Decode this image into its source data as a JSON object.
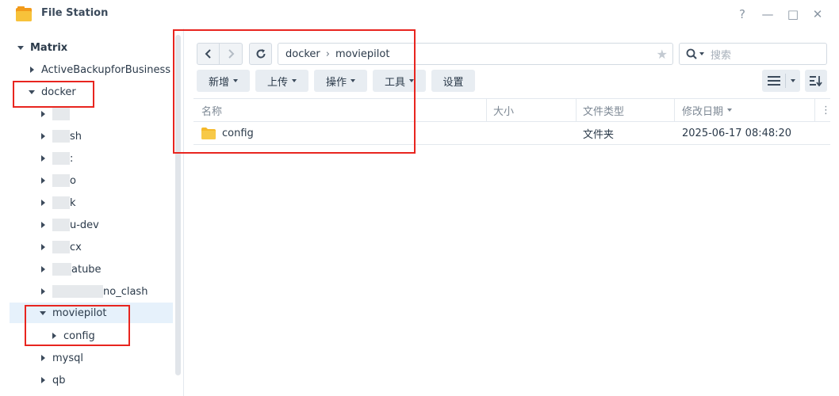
{
  "window": {
    "title": "File Station",
    "controls": {
      "help": "?",
      "minimize": "—",
      "maximize": "□",
      "close": "✕"
    }
  },
  "sidebar": {
    "root": "Matrix",
    "items": [
      {
        "label": "ActiveBackupforBusiness"
      },
      {
        "label": "docker"
      },
      {
        "label": ""
      },
      {
        "label": "sh"
      },
      {
        "label": ":"
      },
      {
        "label": "o"
      },
      {
        "label": "k"
      },
      {
        "label": "u-dev"
      },
      {
        "label": "cx"
      },
      {
        "label": "atube"
      },
      {
        "label": "no_clash"
      },
      {
        "label": "moviepilot"
      },
      {
        "label": "config"
      },
      {
        "label": "mysql"
      },
      {
        "label": "qb"
      }
    ]
  },
  "toolbar": {
    "path": [
      "docker",
      "moviepilot"
    ],
    "search_placeholder": "搜索",
    "buttons": [
      "新增",
      "上传",
      "操作",
      "工具",
      "设置"
    ]
  },
  "file_list": {
    "columns": [
      "名称",
      "大小",
      "文件类型",
      "修改日期"
    ],
    "rows": [
      {
        "name": "config",
        "size": "",
        "type": "文件夹",
        "modified": "2025-06-17 08:48:20"
      }
    ]
  },
  "colors": {
    "folder": "#f5b92b",
    "annotation": "#e8251f",
    "selected": "#e6f1fb"
  },
  "icons": [
    "file-station-icon",
    "back-icon",
    "forward-icon",
    "refresh-icon",
    "star-icon",
    "search-icon",
    "list-view-icon",
    "sort-icon",
    "folder-icon"
  ]
}
